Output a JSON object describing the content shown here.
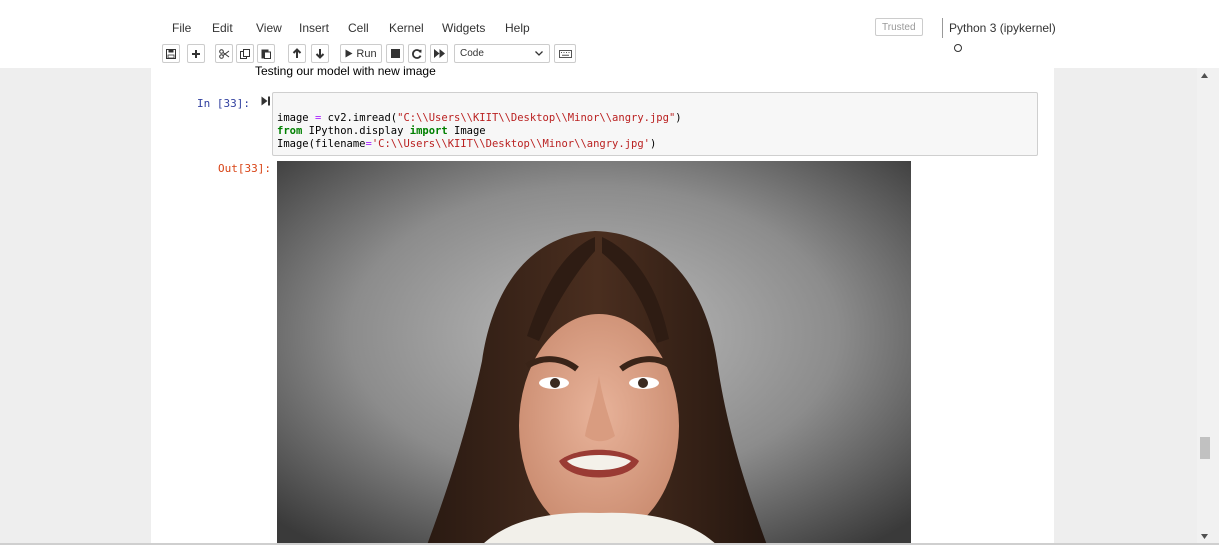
{
  "menu": [
    "File",
    "Edit",
    "View",
    "Insert",
    "Cell",
    "Kernel",
    "Widgets",
    "Help"
  ],
  "trusted": "Trusted",
  "kernel": "Python 3 (ipykernel)",
  "toolbar": {
    "run_label": "Run",
    "cell_type": "Code",
    "icons": [
      "save-icon",
      "add-cell-icon",
      "cut-icon",
      "copy-icon",
      "paste-icon",
      "move-up-icon",
      "move-down-icon",
      "run-icon",
      "stop-icon",
      "restart-icon",
      "fast-forward-icon",
      "keyboard-icon"
    ]
  },
  "notebook": {
    "markdown_text": "Testing our model with new image",
    "input_prompt": "In [33]:",
    "output_prompt": "Out[33]:",
    "code": [
      "image = cv2.imread(\"C:\\\\Users\\\\KIIT\\\\Desktop\\\\Minor\\\\angry.jpg\")",
      "from IPython.display import Image",
      "Image(filename='C:\\\\Users\\\\KIIT\\\\Desktop\\\\Minor\\\\angry.jpg')"
    ]
  },
  "colors": {
    "in_prompt": "#303f9f",
    "out_prompt": "#d84315",
    "keyword": "#008000",
    "string": "#ba2121",
    "operator": "#aa22ff"
  },
  "scrollbar": {
    "position_fraction": 0.88
  }
}
